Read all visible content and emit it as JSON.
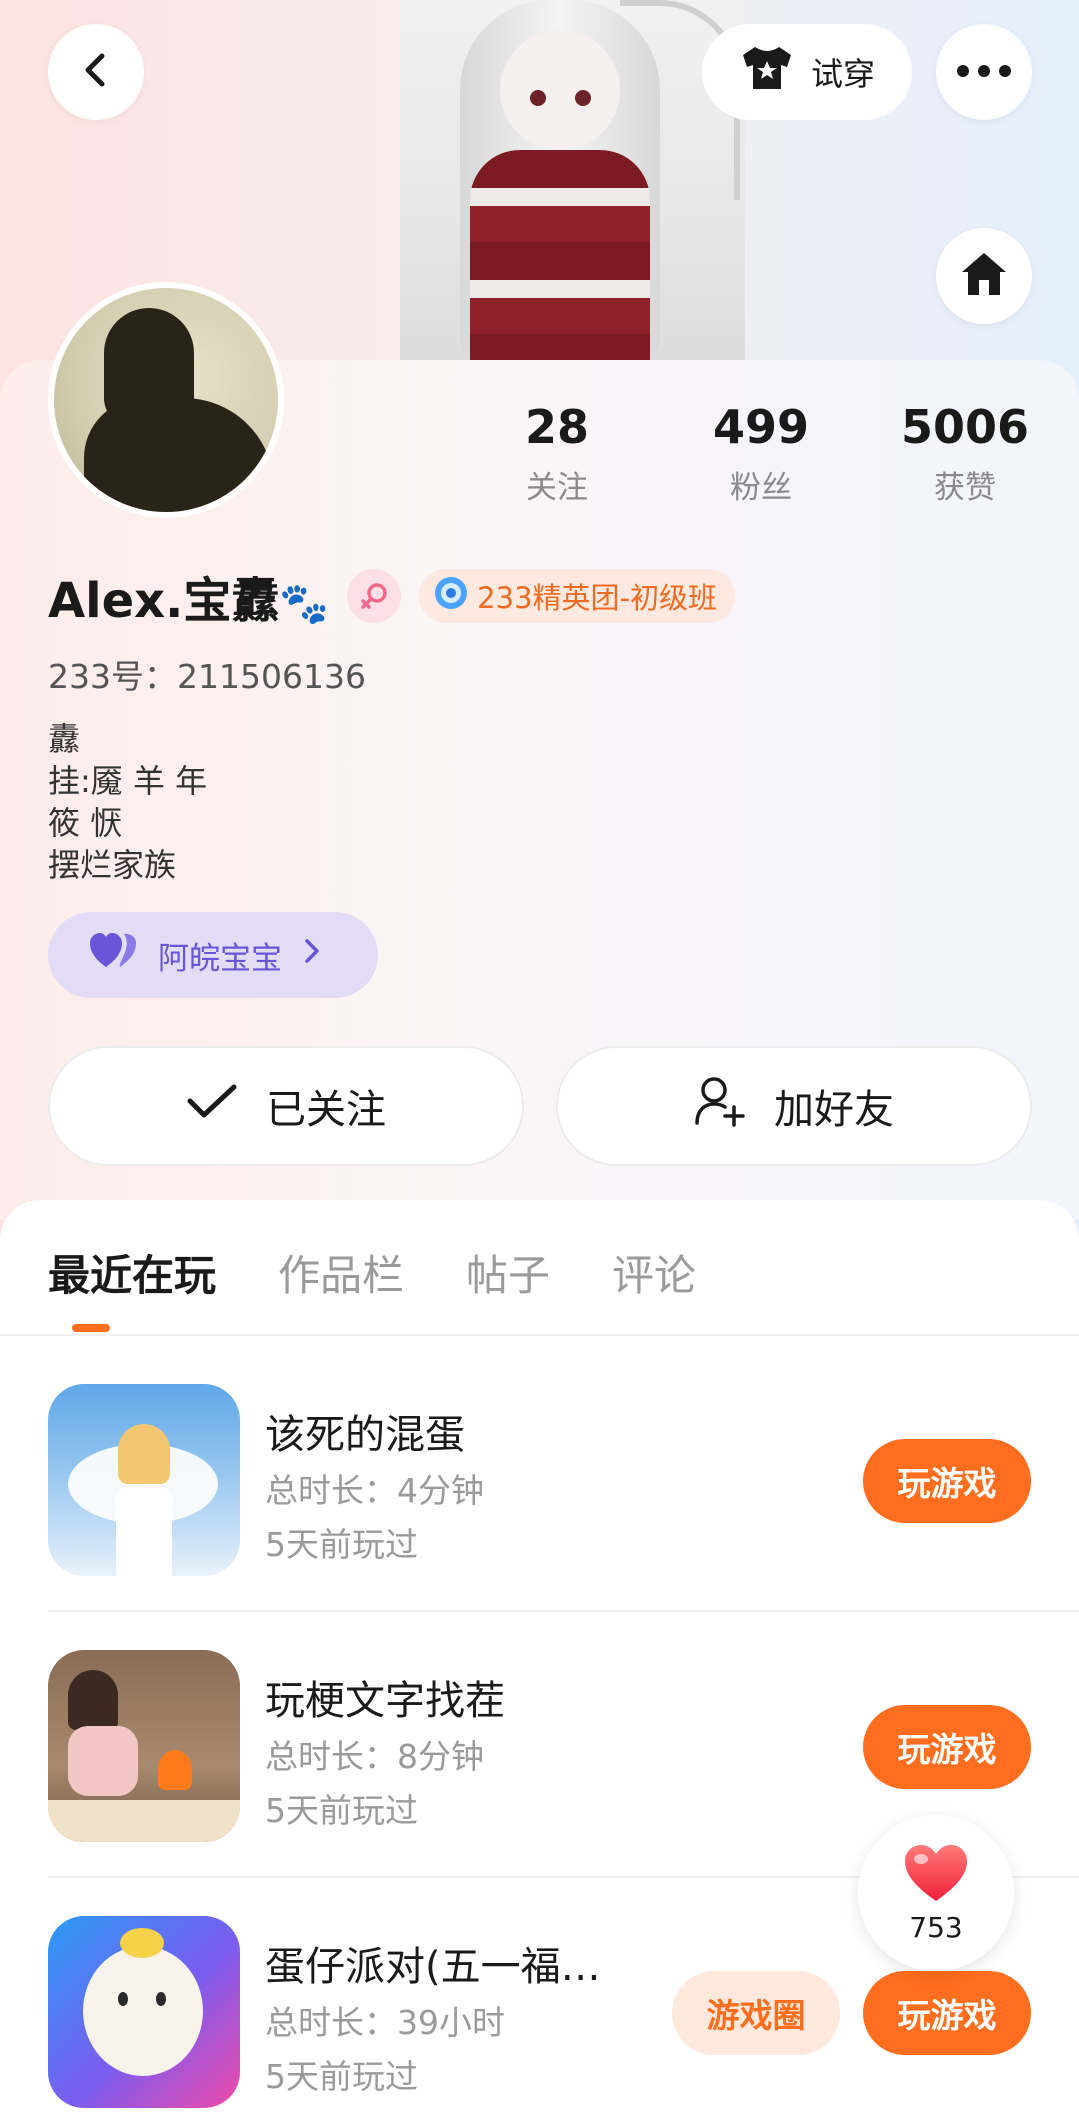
{
  "header": {
    "back_icon": "chevron-left-icon",
    "try_on_label": "试穿",
    "try_on_icon": "shirt-star-icon",
    "more_icon": "more-dots-icon",
    "home_icon": "home-icon"
  },
  "profile": {
    "name": "Alex.宝纛",
    "name_emoji": "🐾",
    "gender_icon": "female-icon",
    "badge_label": "233精英团-初级班",
    "badge_icon": "medal-icon",
    "uid_text": "233号：211506136",
    "bio_lines": [
      "纛",
      "挂:魇 羊 年",
      "筱 恹",
      "摆烂家族"
    ],
    "group_label": "阿皖宝宝"
  },
  "stats": [
    {
      "value": "28",
      "label": "关注"
    },
    {
      "value": "499",
      "label": "粉丝"
    },
    {
      "value": "5006",
      "label": "获赞"
    }
  ],
  "actions": {
    "followed_label": "已关注",
    "add_friend_label": "加好友"
  },
  "tabs": [
    {
      "label": "最近在玩",
      "active": true
    },
    {
      "label": "作品栏",
      "active": false
    },
    {
      "label": "帖子",
      "active": false
    },
    {
      "label": "评论",
      "active": false
    }
  ],
  "games": [
    {
      "title": "该死的混蛋",
      "duration": "总时长：4分钟",
      "last_played": "5天前玩过",
      "play_label": "玩游戏"
    },
    {
      "title": "玩梗文字找茬",
      "duration": "总时长：8分钟",
      "last_played": "5天前玩过",
      "play_label": "玩游戏"
    },
    {
      "title": "蛋仔派对(五一福…",
      "duration": "总时长：39小时",
      "last_played": "5天前玩过",
      "play_label": "玩游戏",
      "circle_label": "游戏圈"
    }
  ],
  "like": {
    "count": "753",
    "icon": "heart-icon"
  },
  "colors": {
    "accent": "#ff6d1f",
    "group_purple": "#6a54d8",
    "badge_orange": "#f06a1f"
  }
}
